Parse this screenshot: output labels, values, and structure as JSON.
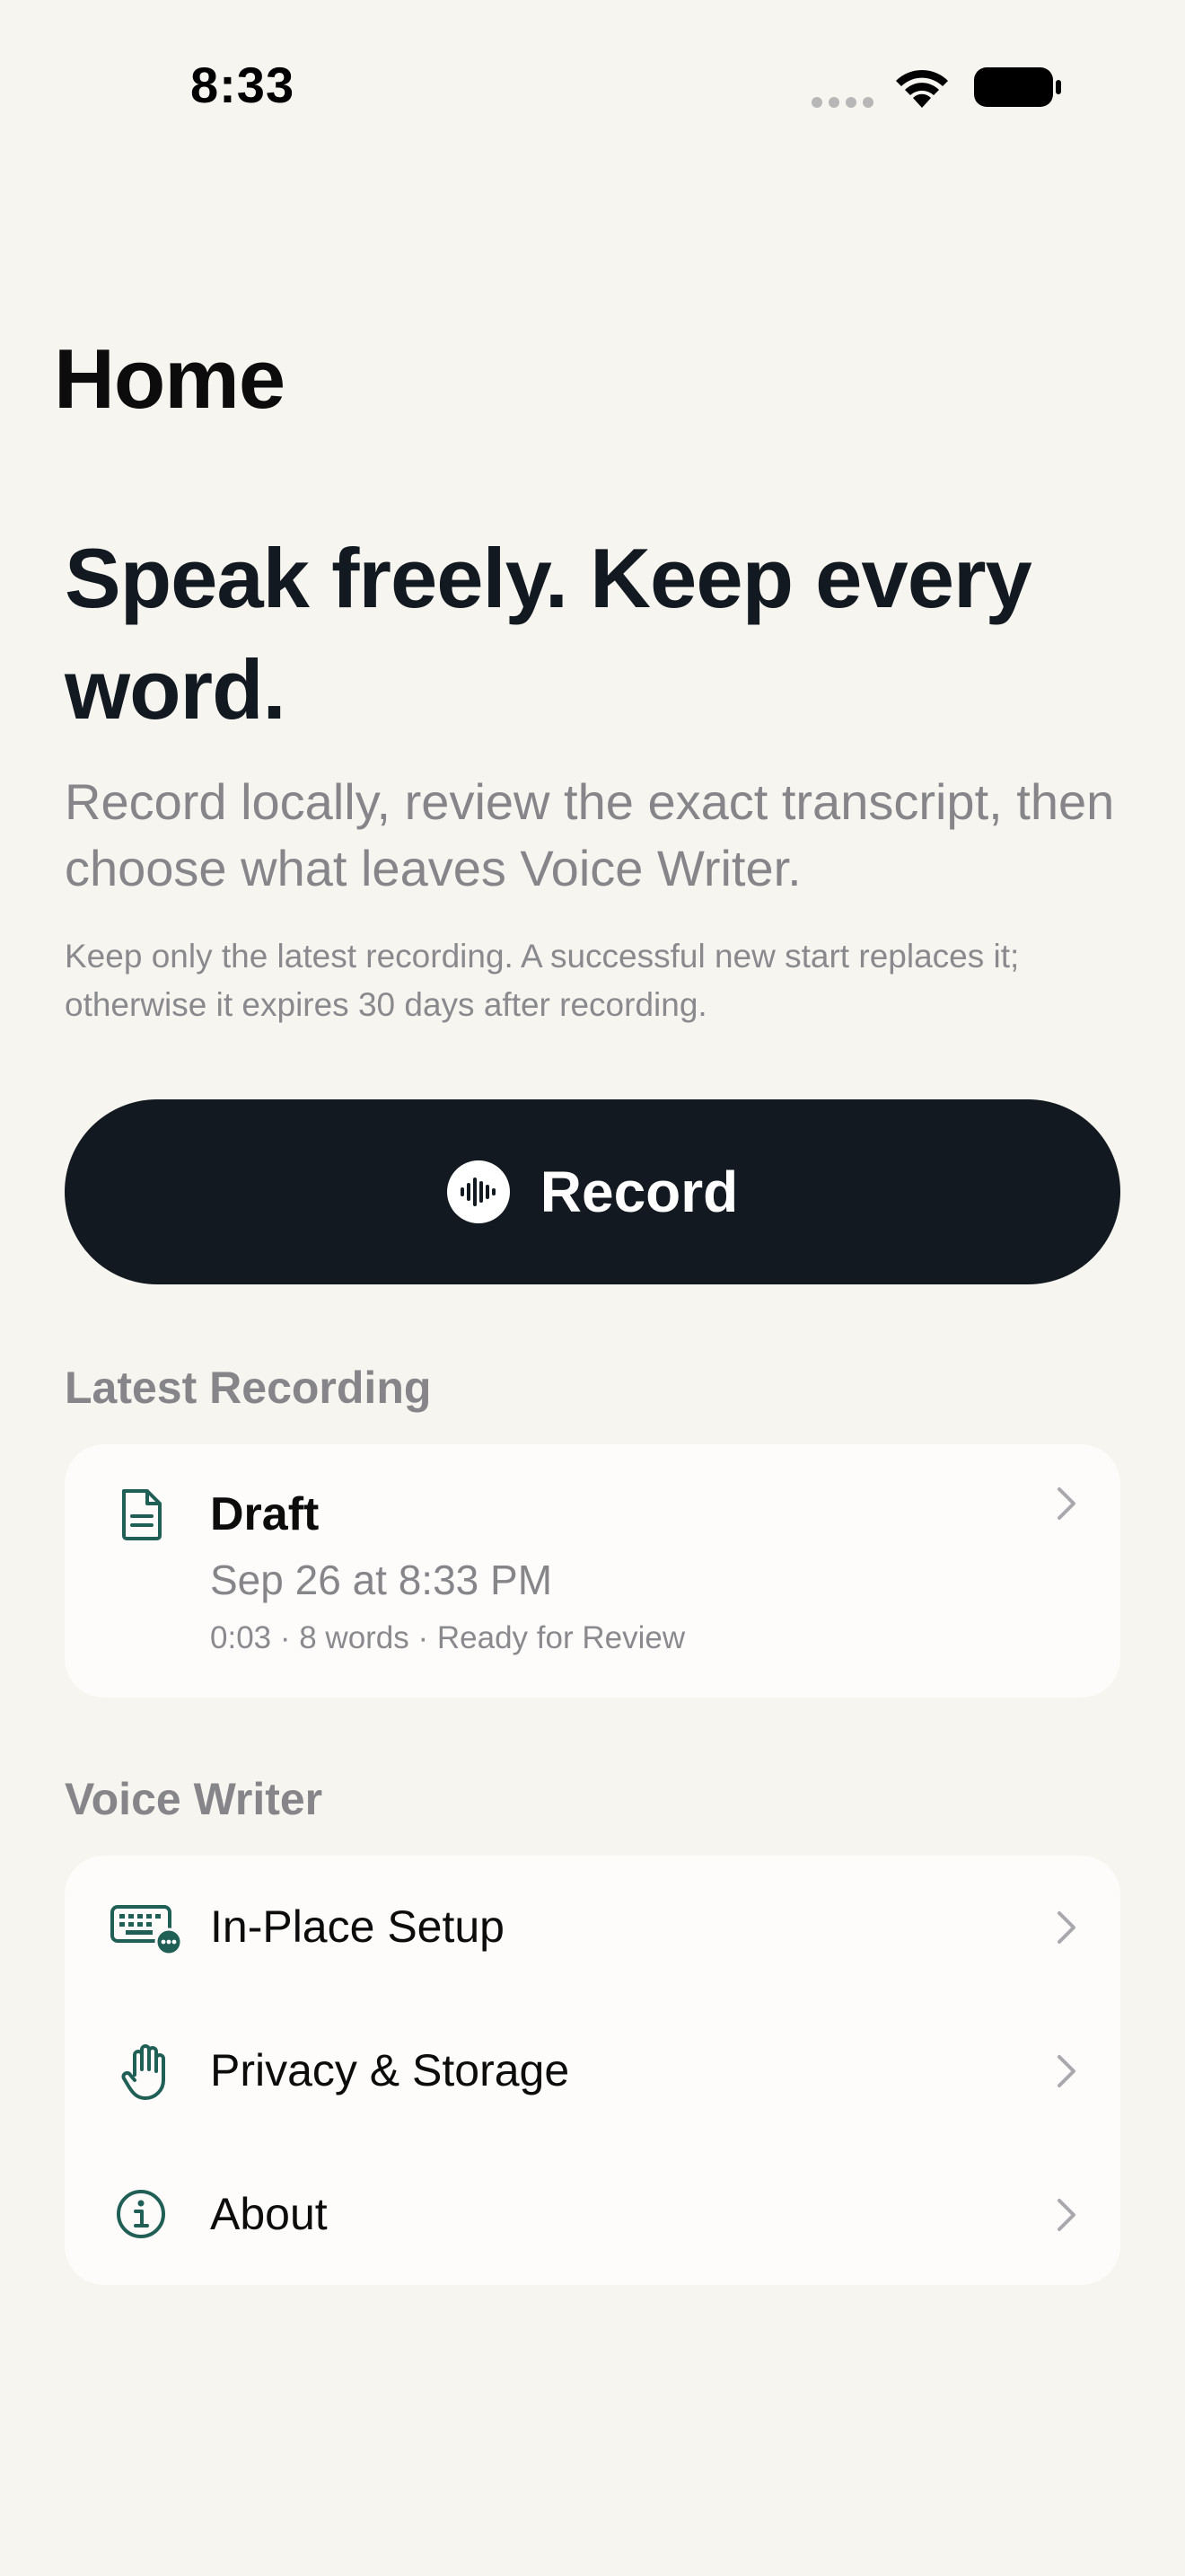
{
  "status_bar": {
    "time": "8:33",
    "signal_icon": "signal-dots-icon",
    "wifi_icon": "wifi-icon",
    "battery_icon": "battery-icon"
  },
  "page": {
    "title": "Home"
  },
  "hero": {
    "title": "Speak freely. Keep every word.",
    "subtitle": "Record locally, review the exact transcript, then choose what leaves Voice Writer.",
    "note": "Keep only the latest recording. A successful new start replaces it; otherwise it expires 30 days after recording."
  },
  "record_button": {
    "label": "Record",
    "icon": "waveform-icon"
  },
  "latest_recording": {
    "header": "Latest Recording",
    "title": "Draft",
    "date": "Sep 26 at 8:33 PM",
    "meta": "0:03 · 8 words · Ready for Review",
    "icon": "document-icon"
  },
  "voice_writer": {
    "header": "Voice Writer",
    "items": [
      {
        "label": "In-Place Setup",
        "icon": "keyboard-icon"
      },
      {
        "label": "Privacy & Storage",
        "icon": "hand-icon"
      },
      {
        "label": "About",
        "icon": "info-icon"
      }
    ]
  },
  "colors": {
    "background": "#f7f5ef",
    "card": "#fdfcfa",
    "primary_dark": "#121920",
    "accent_teal": "#1f5f55",
    "secondary_text": "#85858a"
  }
}
